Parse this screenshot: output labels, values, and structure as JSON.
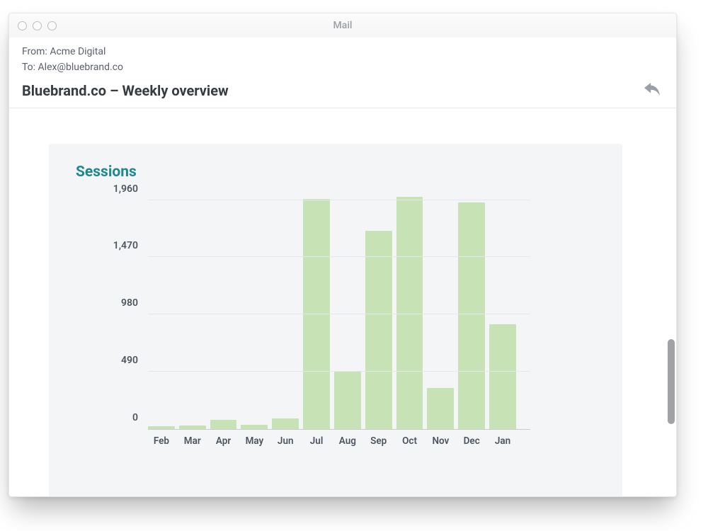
{
  "app": {
    "title": "Mail"
  },
  "mail": {
    "from_label": "From:",
    "from_value": "Acme Digital",
    "to_label": "To:",
    "to_value": "Alex@bluebrand.co",
    "subject": "Bluebrand.co – Weekly overview"
  },
  "card": {
    "title": "Sessions"
  },
  "chart_data": {
    "type": "bar",
    "title": "Sessions",
    "xlabel": "",
    "ylabel": "",
    "ylim": [
      0,
      2000
    ],
    "yticks": [
      0,
      490,
      980,
      1470,
      1960
    ],
    "categories": [
      "Feb",
      "Mar",
      "Apr",
      "May",
      "Jun",
      "Jul",
      "Aug",
      "Sep",
      "Oct",
      "Nov",
      "Dec",
      "Jan"
    ],
    "values": [
      25,
      30,
      80,
      35,
      90,
      1970,
      490,
      1700,
      1990,
      350,
      1940,
      900
    ]
  },
  "colors": {
    "bar": "#c7e2b4",
    "card_bg": "#f3f5f6",
    "title_accent": "#1d8792"
  }
}
